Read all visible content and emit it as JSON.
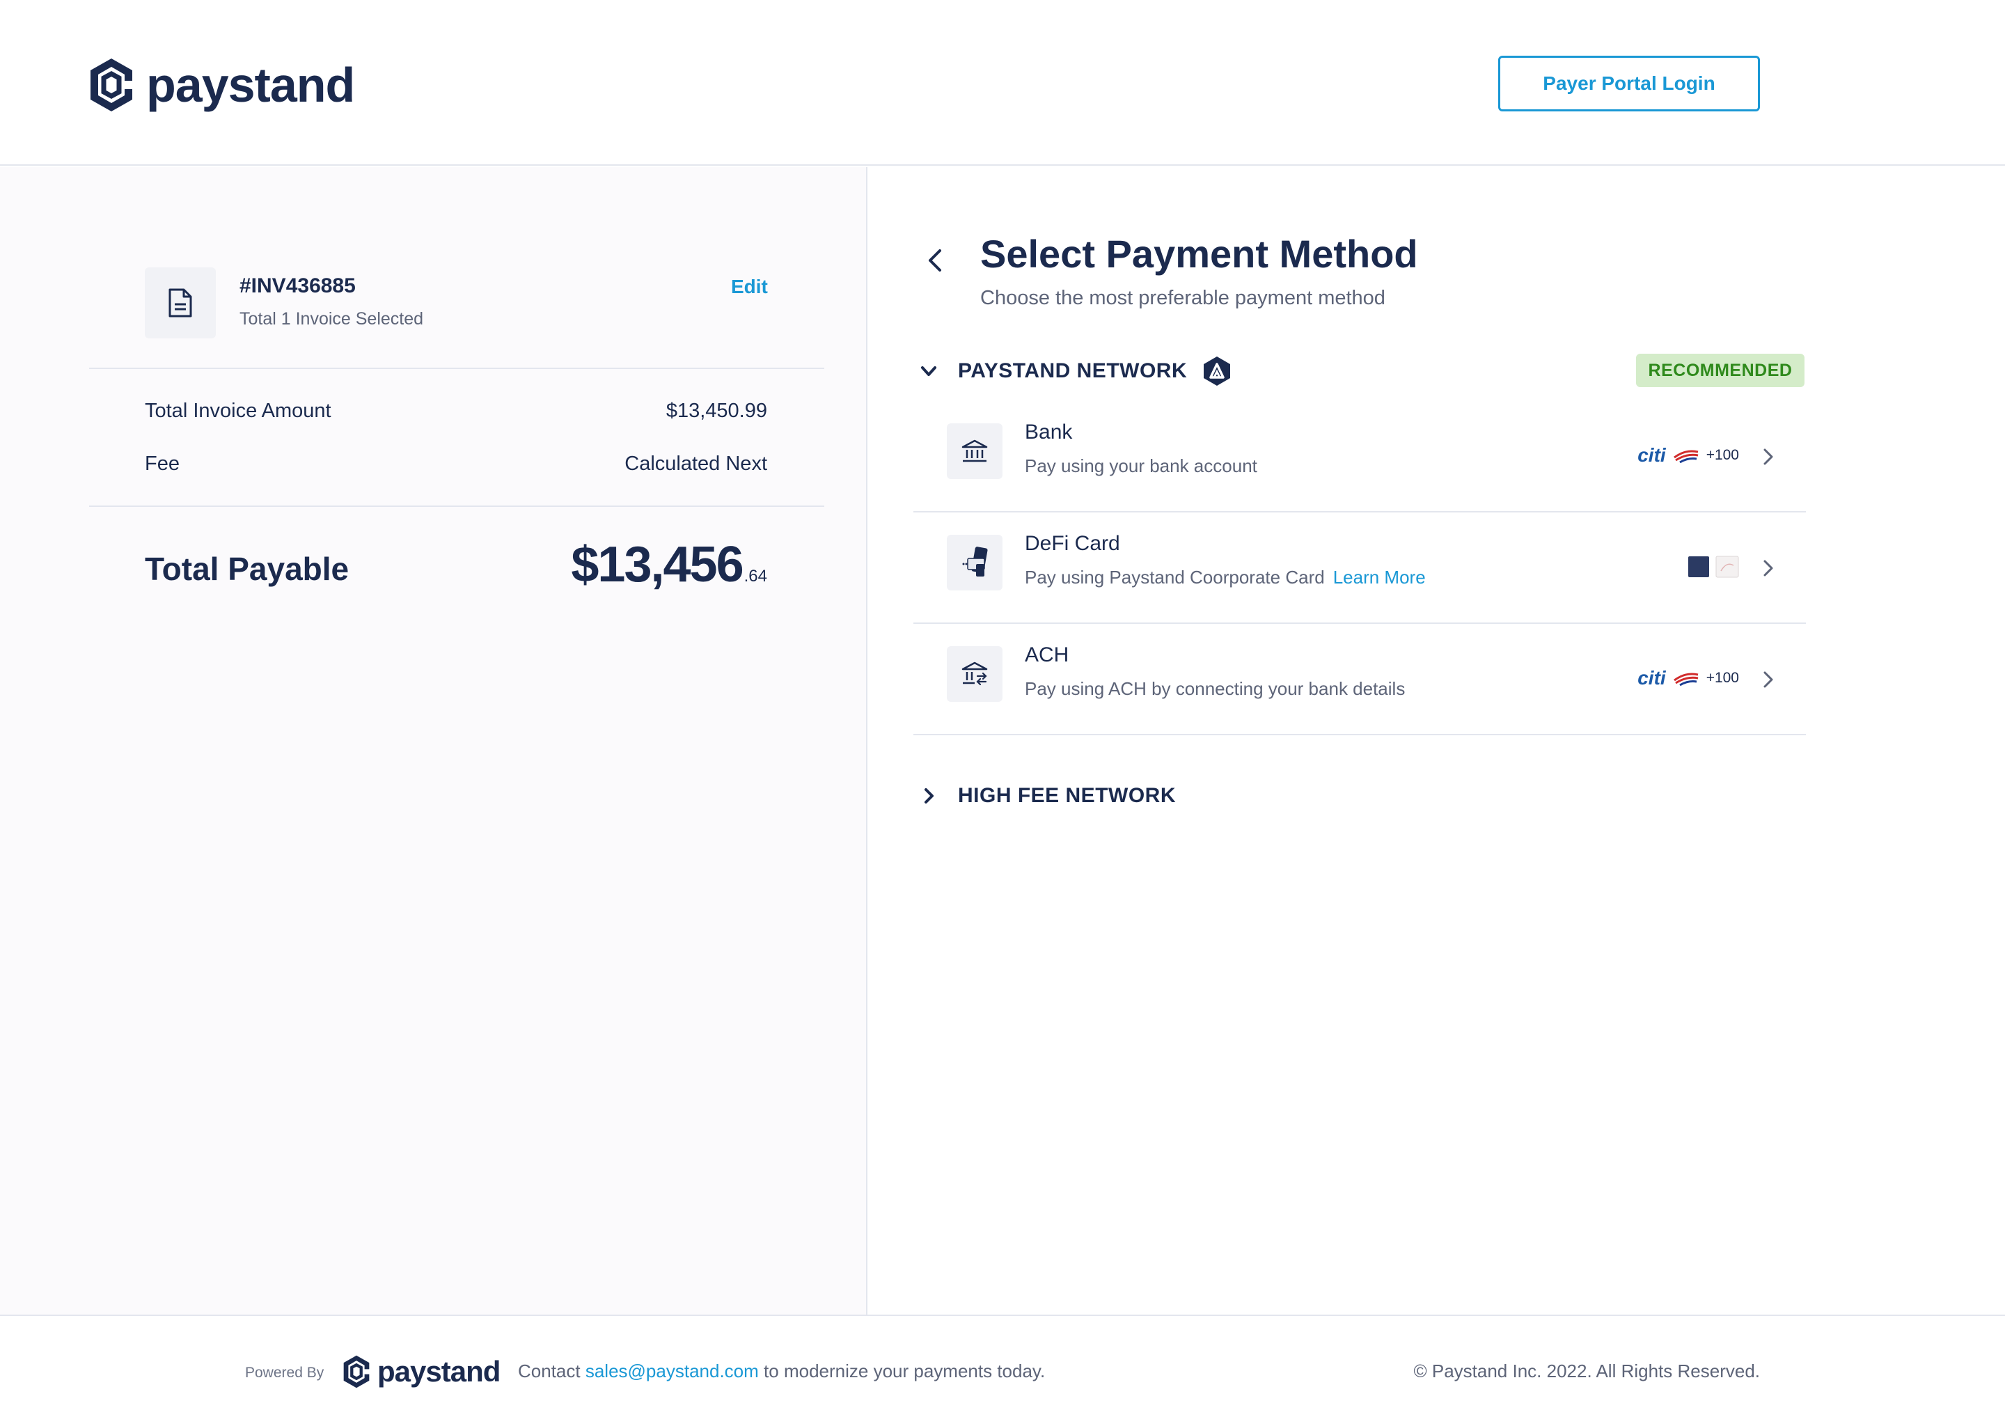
{
  "header": {
    "brand": "paystand",
    "portal_login": "Payer Portal Login"
  },
  "invoice": {
    "number": "#INV436885",
    "selected_text": "Total 1 Invoice Selected",
    "edit_label": "Edit",
    "total_invoice_label": "Total Invoice Amount",
    "total_invoice_value": "$13,450.99",
    "fee_label": "Fee",
    "fee_value": "Calculated Next",
    "total_payable_label": "Total Payable",
    "total_payable_whole": "$13,456",
    "total_payable_cents": ".64"
  },
  "payment": {
    "title": "Select Payment Method",
    "subtitle": "Choose the most preferable payment method",
    "paystand_network": {
      "label": "PAYSTAND NETWORK",
      "badge": "RECOMMENDED",
      "expanded": true
    },
    "methods": [
      {
        "name": "Bank",
        "description": "Pay using your bank account",
        "logos": [
          "citi",
          "bank-of-america"
        ],
        "more": "+100"
      },
      {
        "name": "DeFi Card",
        "description": "Pay using Paystand Coorporate Card",
        "learn_more": "Learn More",
        "logos": [
          "card-dark",
          "card-light"
        ]
      },
      {
        "name": "ACH",
        "description": "Pay using ACH by connecting your bank details",
        "logos": [
          "citi",
          "bank-of-america"
        ],
        "more": "+100"
      }
    ],
    "high_fee_network": {
      "label": "HIGH FEE NETWORK",
      "expanded": false
    }
  },
  "footer": {
    "powered_by": "Powered By",
    "brand": "paystand",
    "contact_prefix": "Contact",
    "contact_email": "sales@paystand.com",
    "contact_suffix": "to modernize your payments today.",
    "copyright": "© Paystand Inc. 2022. All Rights Reserved."
  },
  "colors": {
    "navy": "#1b2a4e",
    "accent": "#1a98d5",
    "recommended_bg": "#d4ecc9",
    "recommended_text": "#2f8a1c",
    "panel_bg": "#fbfafc"
  }
}
